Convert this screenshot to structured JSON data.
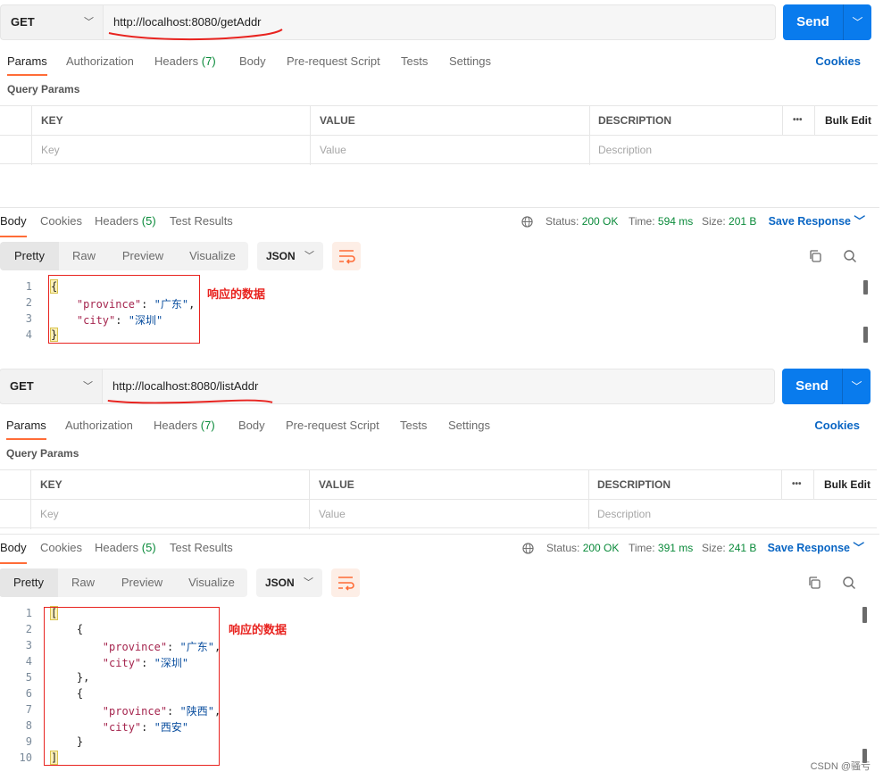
{
  "watermark": "CSDN @骚亏",
  "colors": {
    "accent": "#097bed",
    "tab_underline": "#ff6c37",
    "status_ok": "#0a8a3a",
    "annotation": "#e8231f"
  },
  "panels": [
    {
      "method": "GET",
      "url": "http://localhost:8080/getAddr",
      "send_label": "Send",
      "request_tabs": [
        {
          "label": "Params"
        },
        {
          "label": "Authorization"
        },
        {
          "label": "Headers",
          "count": "(7)"
        },
        {
          "label": "Body"
        },
        {
          "label": "Pre-request Script"
        },
        {
          "label": "Tests"
        },
        {
          "label": "Settings"
        }
      ],
      "cookies_label": "Cookies",
      "query_params_title": "Query Params",
      "table": {
        "headers": [
          "KEY",
          "VALUE",
          "DESCRIPTION"
        ],
        "more_label": "•••",
        "bulk_edit": "Bulk Edit",
        "placeholders": [
          "Key",
          "Value",
          "Description"
        ]
      },
      "response_tabs": [
        {
          "label": "Body"
        },
        {
          "label": "Cookies"
        },
        {
          "label": "Headers",
          "count": "(5)"
        },
        {
          "label": "Test Results"
        }
      ],
      "status": {
        "status_label": "Status:",
        "status_value": "200 OK",
        "time_label": "Time:",
        "time_value": "594 ms",
        "size_label": "Size:",
        "size_value": "201 B"
      },
      "save_response": "Save Response",
      "view_options": [
        "Pretty",
        "Raw",
        "Preview",
        "Visualize"
      ],
      "format": "JSON",
      "code_lines": [
        {
          "n": "1",
          "parts": [
            {
              "t": "{",
              "c": "p"
            }
          ]
        },
        {
          "n": "2",
          "parts": [
            {
              "t": "    ",
              "c": "p"
            },
            {
              "t": "\"province\"",
              "c": "k"
            },
            {
              "t": ": ",
              "c": "p"
            },
            {
              "t": "\"广东\"",
              "c": "s"
            },
            {
              "t": ",",
              "c": "p"
            }
          ]
        },
        {
          "n": "3",
          "parts": [
            {
              "t": "    ",
              "c": "p"
            },
            {
              "t": "\"city\"",
              "c": "k"
            },
            {
              "t": ": ",
              "c": "p"
            },
            {
              "t": "\"深圳\"",
              "c": "s"
            }
          ]
        },
        {
          "n": "4",
          "parts": [
            {
              "t": "}",
              "c": "p"
            }
          ]
        }
      ],
      "annotation": "响应的数据"
    },
    {
      "method": "GET",
      "url": "http://localhost:8080/listAddr",
      "send_label": "Send",
      "request_tabs": [
        {
          "label": "Params"
        },
        {
          "label": "Authorization"
        },
        {
          "label": "Headers",
          "count": "(7)"
        },
        {
          "label": "Body"
        },
        {
          "label": "Pre-request Script"
        },
        {
          "label": "Tests"
        },
        {
          "label": "Settings"
        }
      ],
      "cookies_label": "Cookies",
      "query_params_title": "Query Params",
      "table": {
        "headers": [
          "KEY",
          "VALUE",
          "DESCRIPTION"
        ],
        "more_label": "•••",
        "bulk_edit": "Bulk Edit",
        "placeholders": [
          "Key",
          "Value",
          "Description"
        ]
      },
      "response_tabs": [
        {
          "label": "Body"
        },
        {
          "label": "Cookies"
        },
        {
          "label": "Headers",
          "count": "(5)"
        },
        {
          "label": "Test Results"
        }
      ],
      "status": {
        "status_label": "Status:",
        "status_value": "200 OK",
        "time_label": "Time:",
        "time_value": "391 ms",
        "size_label": "Size:",
        "size_value": "241 B"
      },
      "save_response": "Save Response",
      "view_options": [
        "Pretty",
        "Raw",
        "Preview",
        "Visualize"
      ],
      "format": "JSON",
      "code_lines": [
        {
          "n": "1",
          "parts": [
            {
              "t": "[",
              "c": "p"
            }
          ]
        },
        {
          "n": "2",
          "parts": [
            {
              "t": "    {",
              "c": "p"
            }
          ]
        },
        {
          "n": "3",
          "parts": [
            {
              "t": "        ",
              "c": "p"
            },
            {
              "t": "\"province\"",
              "c": "k"
            },
            {
              "t": ": ",
              "c": "p"
            },
            {
              "t": "\"广东\"",
              "c": "s"
            },
            {
              "t": ",",
              "c": "p"
            }
          ]
        },
        {
          "n": "4",
          "parts": [
            {
              "t": "        ",
              "c": "p"
            },
            {
              "t": "\"city\"",
              "c": "k"
            },
            {
              "t": ": ",
              "c": "p"
            },
            {
              "t": "\"深圳\"",
              "c": "s"
            }
          ]
        },
        {
          "n": "5",
          "parts": [
            {
              "t": "    },",
              "c": "p"
            }
          ]
        },
        {
          "n": "6",
          "parts": [
            {
              "t": "    {",
              "c": "p"
            }
          ]
        },
        {
          "n": "7",
          "parts": [
            {
              "t": "        ",
              "c": "p"
            },
            {
              "t": "\"province\"",
              "c": "k"
            },
            {
              "t": ": ",
              "c": "p"
            },
            {
              "t": "\"陕西\"",
              "c": "s"
            },
            {
              "t": ",",
              "c": "p"
            }
          ]
        },
        {
          "n": "8",
          "parts": [
            {
              "t": "        ",
              "c": "p"
            },
            {
              "t": "\"city\"",
              "c": "k"
            },
            {
              "t": ": ",
              "c": "p"
            },
            {
              "t": "\"西安\"",
              "c": "s"
            }
          ]
        },
        {
          "n": "9",
          "parts": [
            {
              "t": "    }",
              "c": "p"
            }
          ]
        },
        {
          "n": "10",
          "parts": [
            {
              "t": "]",
              "c": "p"
            }
          ]
        }
      ],
      "annotation": "响应的数据"
    }
  ]
}
